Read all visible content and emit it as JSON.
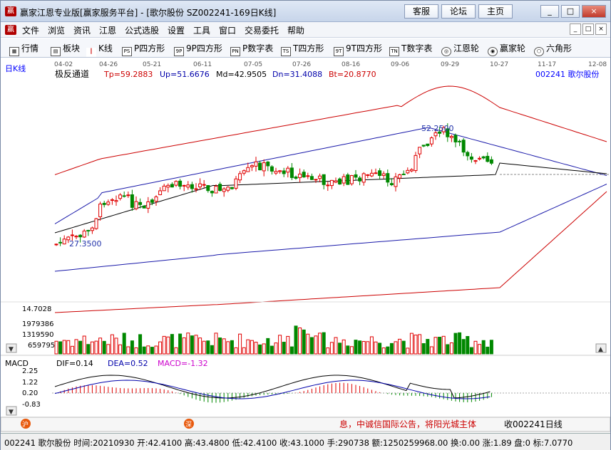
{
  "window": {
    "title": "赢家江恩专业版[赢家服务平台] - [歌尔股份  SZ002241-169日K线]",
    "top_buttons": [
      "客服",
      "论坛",
      "主页"
    ],
    "controls": [
      "_",
      "□",
      "×"
    ]
  },
  "menu": [
    "文件",
    "浏览",
    "资讯",
    "江恩",
    "公式选股",
    "设置",
    "工具",
    "窗口",
    "交易委托",
    "帮助"
  ],
  "mdi_controls": [
    "_",
    "□",
    "×"
  ],
  "toolbar": [
    "行情",
    "板块",
    "K线",
    "P四方形",
    "9P四方形",
    "P数字表",
    "T四方形",
    "9T四方形",
    "T数字表",
    "江恩轮",
    "赢家轮",
    "六角形"
  ],
  "toolbar_icons": [
    "grid-icon",
    "blocks-icon",
    "candles-icon",
    "ps-icon",
    "9p-icon",
    "pn-icon",
    "ts-icon",
    "9t-icon",
    "tn-icon",
    "wheel-icon",
    "big-wheel-icon",
    "hexagon-icon"
  ],
  "chart": {
    "period_label": "日K线",
    "stock_label": "002241  歌尔股份",
    "date_ticks": [
      "04-02",
      "04-26",
      "05-21",
      "06-11",
      "07-05",
      "07-26",
      "08-16",
      "09-06",
      "09-29",
      "10-27",
      "11-17",
      "12-08"
    ],
    "indicator_name": "极反通道",
    "indicator_values": [
      "Tp=59.2883",
      "Up=51.6676",
      "Md=42.9505",
      "Dn=31.4088",
      "Bt=20.8770"
    ],
    "high_marker": "52.2500",
    "low_marker": "27.3500",
    "volume_labels": [
      "14.7028",
      "1979386",
      "1319590",
      "659795"
    ],
    "macd_name": "MACD",
    "macd_values": [
      "DIF=0.14",
      "DEA=0.52",
      "MACD=-1.32"
    ],
    "macd_axis": [
      "2.25",
      "1.22",
      "0.20",
      "-0.83"
    ],
    "ticker": "息，中诚信国际公告，将阳光城主体",
    "ticker_right": "收002241日线",
    "ticker_icons": [
      "沪",
      "深"
    ]
  },
  "colors": {
    "up": "#e00000",
    "down": "#008800",
    "upper_band": "#cc0000",
    "mid_band": "#1a1aaa",
    "ma": "#000000"
  },
  "status": "002241 歌尔股份 时间:20210930 开:42.4100 高:43.4800 低:42.4100 收:43.1000 手:290738 额:1250259968.00 换:0.00 涨:1.89 盘:0 标:7.0770"
}
